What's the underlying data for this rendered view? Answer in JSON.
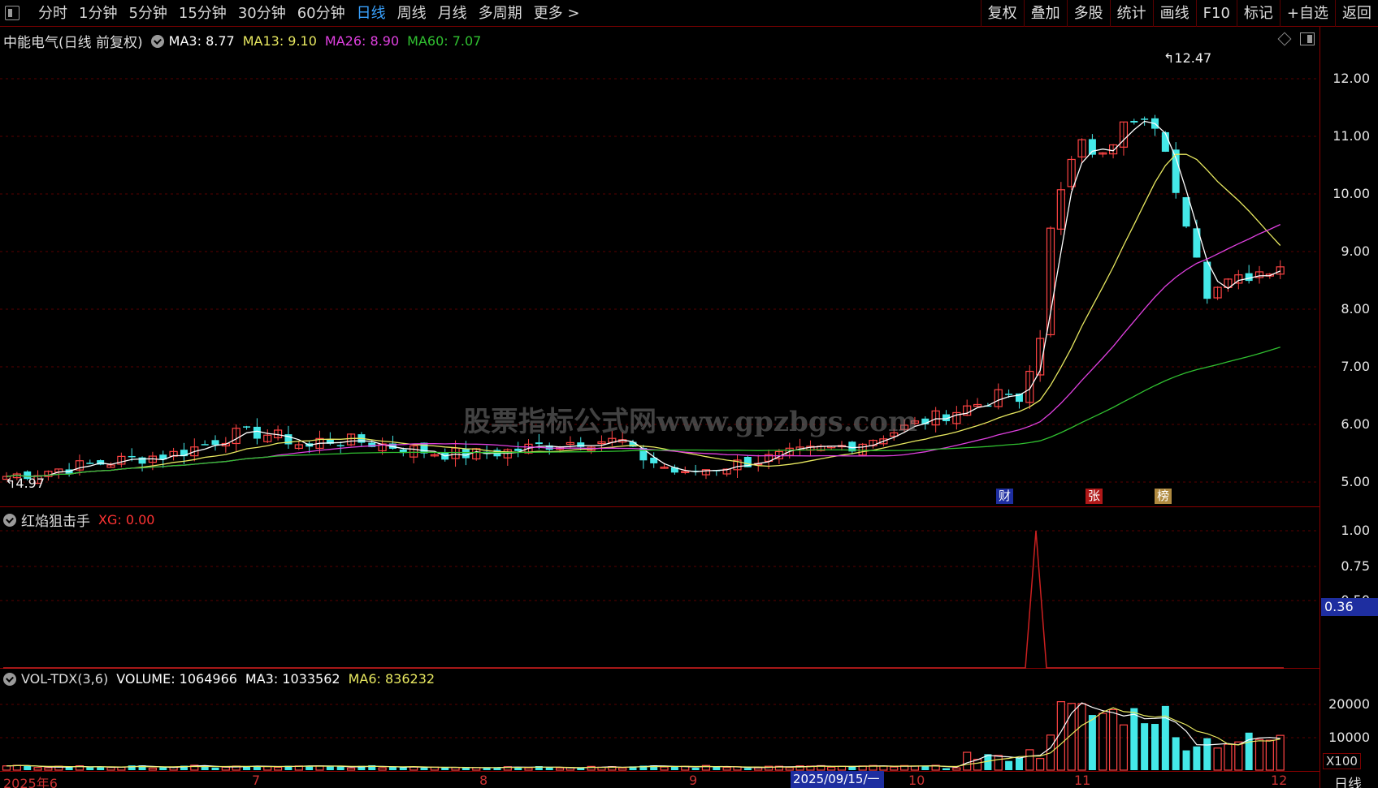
{
  "topbar": {
    "period_tabs": [
      "分时",
      "1分钟",
      "5分钟",
      "15分钟",
      "30分钟",
      "60分钟",
      "日线",
      "周线",
      "月线",
      "多周期",
      "更多 >"
    ],
    "active_period": "日线",
    "right_tabs": [
      "复权",
      "叠加",
      "多股",
      "统计",
      "画线",
      "F10",
      "标记",
      "+自选",
      "返回"
    ]
  },
  "main_panel": {
    "legend": {
      "title": "中能电气(日线 前复权)",
      "ma3": "MA3: 8.77",
      "ma13": "MA13: 9.10",
      "ma26": "MA26: 8.90",
      "ma60": "MA60: 7.07"
    },
    "y_ticks": [
      "12.00",
      "11.00",
      "10.00",
      "9.00",
      "8.00",
      "7.00",
      "6.00",
      "5.00"
    ],
    "high_label": "12.47",
    "low_label": "4.97",
    "markers": [
      "财",
      "张",
      "榜"
    ],
    "watermark": "股票指标公式网www.gpzbgs.com"
  },
  "indicator_panel": {
    "name": "红焰狙击手",
    "xg": "XG: 0.00",
    "y_ticks": [
      "1.00",
      "0.75",
      "0.50"
    ],
    "current_value": "0.36"
  },
  "volume_panel": {
    "name": "VOL-TDX(3,6)",
    "volume": "VOLUME: 1064966",
    "ma3": "MA3: 1033562",
    "ma6": "MA6: 836232",
    "y_ticks": [
      "20000",
      "10000"
    ],
    "unit": "X100"
  },
  "x_axis": {
    "labels": [
      "2025年6",
      "7",
      "8",
      "9",
      "10",
      "11",
      "12"
    ],
    "cursor_date": "2025/09/15/一",
    "period_label": "日线"
  },
  "colors": {
    "up": "#ff4444",
    "down": "#44e8e8",
    "ma3": "#ffffff",
    "ma13": "#e8e860",
    "ma26": "#e040e0",
    "ma60": "#30c030",
    "grid": "#7a0000"
  }
}
